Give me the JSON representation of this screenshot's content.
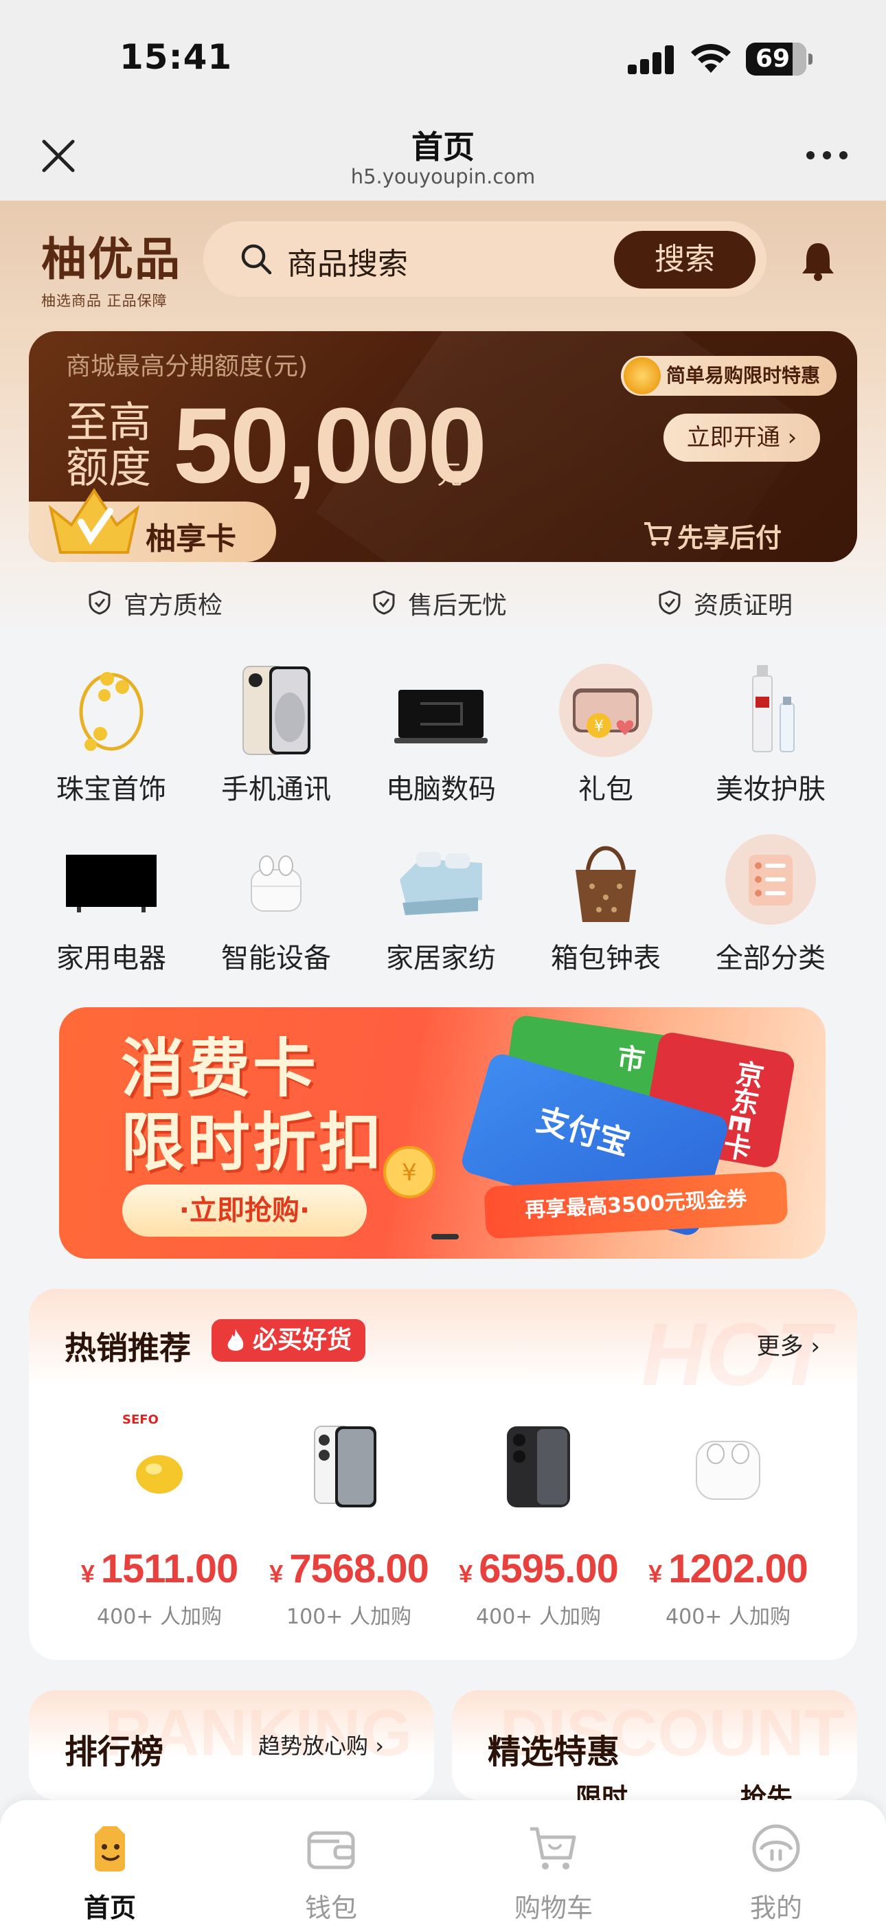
{
  "status_bar": {
    "time": "15:41",
    "battery": "69"
  },
  "navbar": {
    "title": "首页",
    "url": "h5.youyoupin.com"
  },
  "header": {
    "logo_name": "柚优品",
    "logo_sub": "柚选商品 正品保障",
    "search_placeholder": "商品搜索",
    "search_button": "搜索"
  },
  "credit_card": {
    "label": "商城最高分期额度(元)",
    "prefix": "至高\n额度",
    "amount": "50,000",
    "unit": "元",
    "promo": "简单易购限时特惠",
    "open_button": "立即开通",
    "badge": "柚享卡",
    "pay_later": "先享后付"
  },
  "assurances": [
    "官方质检",
    "售后无忧",
    "资质证明"
  ],
  "categories": [
    {
      "label": "珠宝首饰",
      "icon": "jewelry-icon"
    },
    {
      "label": "手机通讯",
      "icon": "phone-icon"
    },
    {
      "label": "电脑数码",
      "icon": "laptop-icon"
    },
    {
      "label": "礼包",
      "icon": "gift-pack-icon"
    },
    {
      "label": "美妆护肤",
      "icon": "cosmetics-icon"
    },
    {
      "label": "家用电器",
      "icon": "tv-icon"
    },
    {
      "label": "智能设备",
      "icon": "earbuds-icon"
    },
    {
      "label": "家居家纺",
      "icon": "bedding-icon"
    },
    {
      "label": "箱包钟表",
      "icon": "handbag-icon"
    },
    {
      "label": "全部分类",
      "icon": "all-categories-icon"
    }
  ],
  "banner": {
    "line1": "消费卡",
    "line2": "限时折扣",
    "cta": "·立即抢购·",
    "footer": "再享最高3500元现金券",
    "cards": [
      "天猫超市",
      "京东E卡",
      "支付宝"
    ]
  },
  "hot": {
    "title": "热销推荐",
    "tag": "必买好货",
    "more": "更多",
    "bg_word": "HOT",
    "products": [
      {
        "price": "1511.00",
        "count": "400+ 人加购",
        "icon": "gold-bean-icon"
      },
      {
        "price": "7568.00",
        "count": "100+ 人加购",
        "icon": "iphone-silver-icon"
      },
      {
        "price": "6595.00",
        "count": "400+ 人加购",
        "icon": "iphone-black-icon"
      },
      {
        "price": "1202.00",
        "count": "400+ 人加购",
        "icon": "airpods-icon"
      }
    ],
    "currency": "¥"
  },
  "ranking": {
    "title": "排行榜",
    "subtitle": "趋势放心购",
    "bg_word": "RANKING"
  },
  "discount": {
    "title": "精选特惠",
    "bg_word": "DISCOUNT",
    "mini1": "限时",
    "mini2": "抢先"
  },
  "tabbar": [
    {
      "label": "首页",
      "icon": "home-face-icon",
      "active": true
    },
    {
      "label": "钱包",
      "icon": "wallet-icon",
      "active": false
    },
    {
      "label": "购物车",
      "icon": "cart-icon",
      "active": false
    },
    {
      "label": "我的",
      "icon": "profile-icon",
      "active": false
    }
  ],
  "colors": {
    "brand_dark": "#4a1f0c",
    "accent_red": "#e8403c",
    "beige": "#f6dcc4"
  }
}
